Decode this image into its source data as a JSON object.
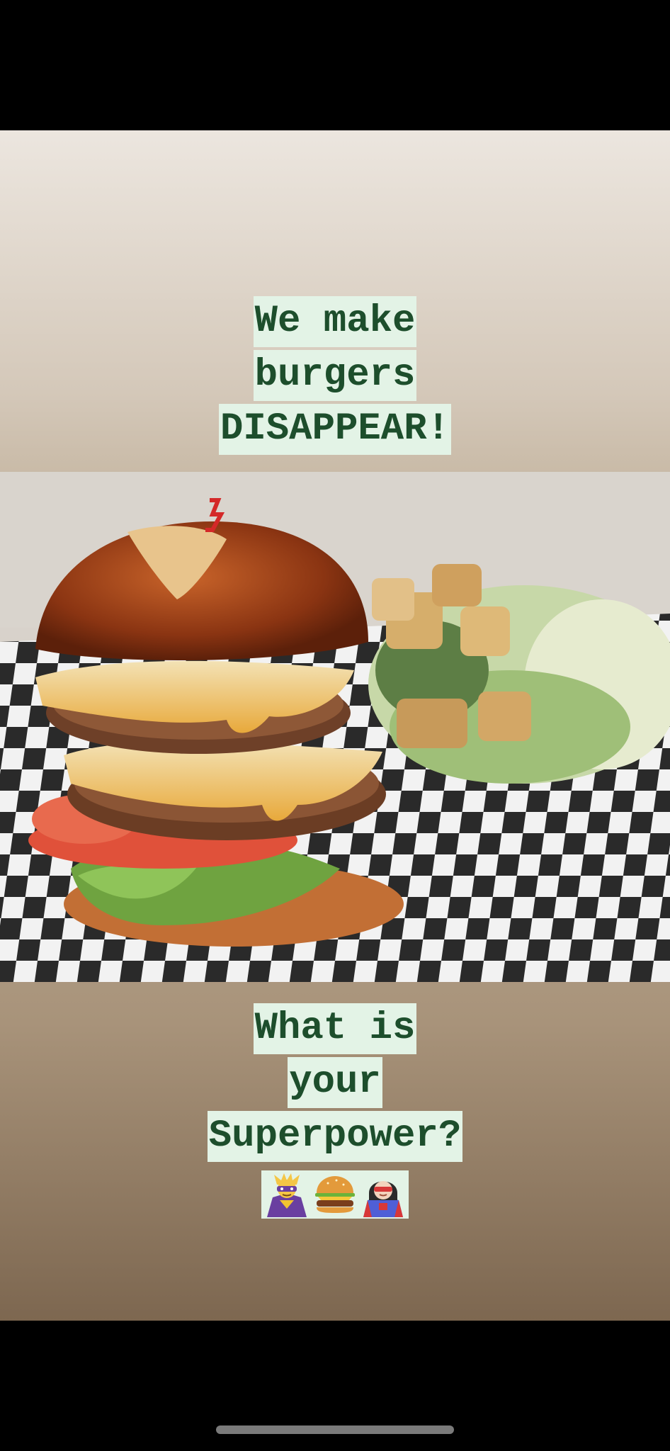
{
  "story": {
    "top_caption": {
      "lines": [
        "We make",
        "burgers",
        "DISAPPEAR!"
      ]
    },
    "bottom_caption": {
      "lines": [
        "What is",
        "your",
        "Superpower?"
      ]
    },
    "emojis": [
      "supervillain-icon",
      "burger-icon",
      "superhero-woman-icon"
    ],
    "photo": "burger-and-caesar-salad-photo"
  },
  "colors": {
    "caption_bg": "#e3f3e6",
    "caption_text": "#1d4e2c"
  }
}
